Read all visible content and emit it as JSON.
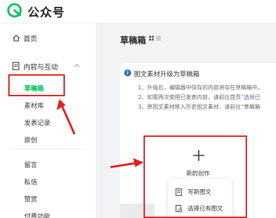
{
  "app": {
    "title": "公众号"
  },
  "sidebar": {
    "home": "首页",
    "content_section": "内容与互动",
    "sub_items": [
      "草稿箱",
      "素材库",
      "发表记录",
      "原创"
    ],
    "other_items": [
      "留言",
      "私信",
      "赞赏",
      "付费功能"
    ]
  },
  "main": {
    "title": "草稿箱",
    "notice": {
      "title": "图文素材升级为草稿箱",
      "lines": [
        {
          "text": "1、升级后，编辑器中保存的内容将存在草稿箱中。",
          "link": ""
        },
        {
          "text": "2、如需再次使用已发表内容，请前往首页“",
          "link": "选择已"
        },
        {
          "text": "3、原图文素材移入历史图文素材，请前往“草稿箱",
          "link": ""
        }
      ]
    },
    "create": {
      "label": "新的创作",
      "menu": [
        "写新图文",
        "选择已有图文"
      ]
    }
  },
  "colors": {
    "accent": "#07c160",
    "annotation": "#e02020",
    "info": "#1f6fd6",
    "link": "#576b95"
  },
  "icons": {
    "logo": "wechat-official-account-logo",
    "home": "home-icon",
    "content": "document-icon",
    "chevron": "chevron-up-icon",
    "info": "info-icon",
    "plus": "plus-icon",
    "write": "document-edit-icon",
    "select": "document-select-icon"
  }
}
